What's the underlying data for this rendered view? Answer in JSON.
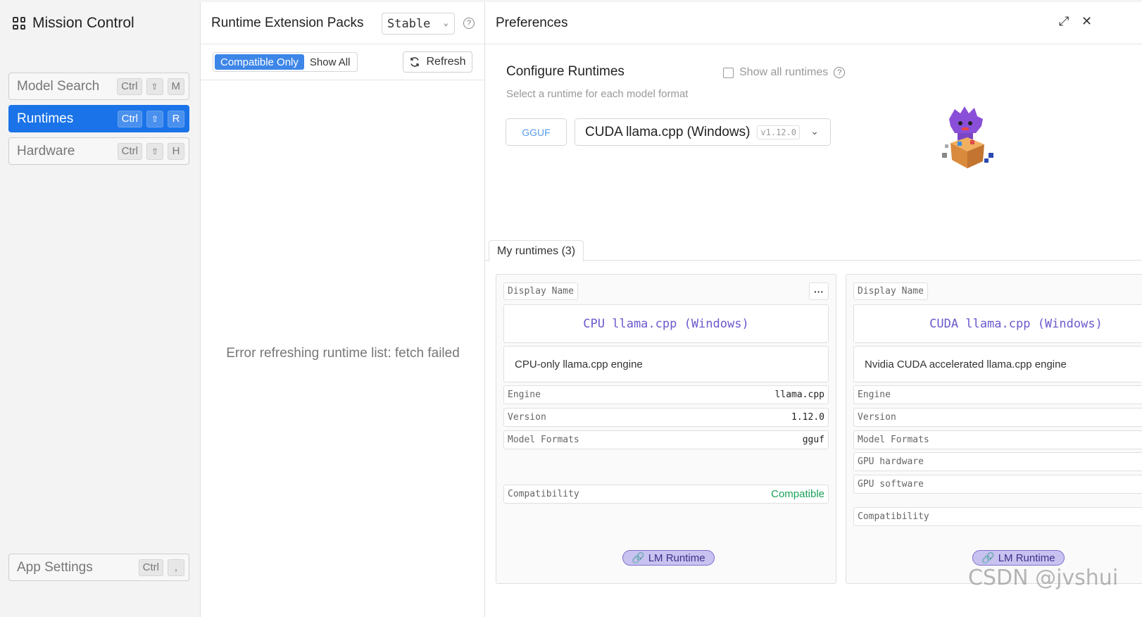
{
  "sidebar": {
    "title": "Mission Control",
    "items": [
      {
        "label": "Model Search",
        "keys": [
          "Ctrl",
          "⇧",
          "M"
        ]
      },
      {
        "label": "Runtimes",
        "keys": [
          "Ctrl",
          "⇧",
          "R"
        ]
      },
      {
        "label": "Hardware",
        "keys": [
          "Ctrl",
          "⇧",
          "H"
        ]
      }
    ],
    "settings": {
      "label": "App Settings",
      "keys": [
        "Ctrl",
        ","
      ]
    }
  },
  "middle": {
    "title": "Runtime Extension Packs",
    "channel": "Stable",
    "filter_compatible": "Compatible Only",
    "filter_all": "Show All",
    "refresh_label": "Refresh",
    "error": "Error refreshing runtime list: fetch failed"
  },
  "preferences": {
    "title": "Preferences",
    "configure_title": "Configure Runtimes",
    "configure_sub": "Select a runtime for each model format",
    "show_all_label": "Show all runtimes",
    "format": "GGUF",
    "selected_runtime": "CUDA llama.cpp (Windows)",
    "selected_version": "v1.12.0",
    "tab_label": "My runtimes (3)",
    "cards": [
      {
        "display_name_label": "Display Name",
        "name": "CPU llama.cpp (Windows)",
        "description": "CPU-only llama.cpp engine",
        "rows": [
          {
            "key": "Engine",
            "value": "llama.cpp"
          },
          {
            "key": "Version",
            "value": "1.12.0"
          },
          {
            "key": "Model Formats",
            "value": "gguf"
          }
        ],
        "compat_label": "Compatibility",
        "compat_value": "Compatible",
        "badge": "LM Runtime"
      },
      {
        "display_name_label": "Display Name",
        "name": "CUDA llama.cpp (Windows)",
        "description": "Nvidia CUDA accelerated llama.cpp engine",
        "rows": [
          {
            "key": "Engine",
            "value": ""
          },
          {
            "key": "Version",
            "value": ""
          },
          {
            "key": "Model Formats",
            "value": ""
          },
          {
            "key": "GPU hardware",
            "value": ""
          },
          {
            "key": "GPU software",
            "value": ""
          }
        ],
        "compat_label": "Compatibility",
        "compat_value": "",
        "badge": "LM Runtime"
      }
    ]
  },
  "watermark": "CSDN @jvshui",
  "colors": {
    "accent": "#1a73e8",
    "compatible": "#1aa05a",
    "badge_bg": "#c8c2f0",
    "runtime_name": "#6a5acd"
  },
  "icons": [
    "grid-icon",
    "help-icon",
    "refresh-icon",
    "expand-icon",
    "close-icon",
    "chevron-down-icon",
    "link-icon",
    "mascot-icon"
  ]
}
